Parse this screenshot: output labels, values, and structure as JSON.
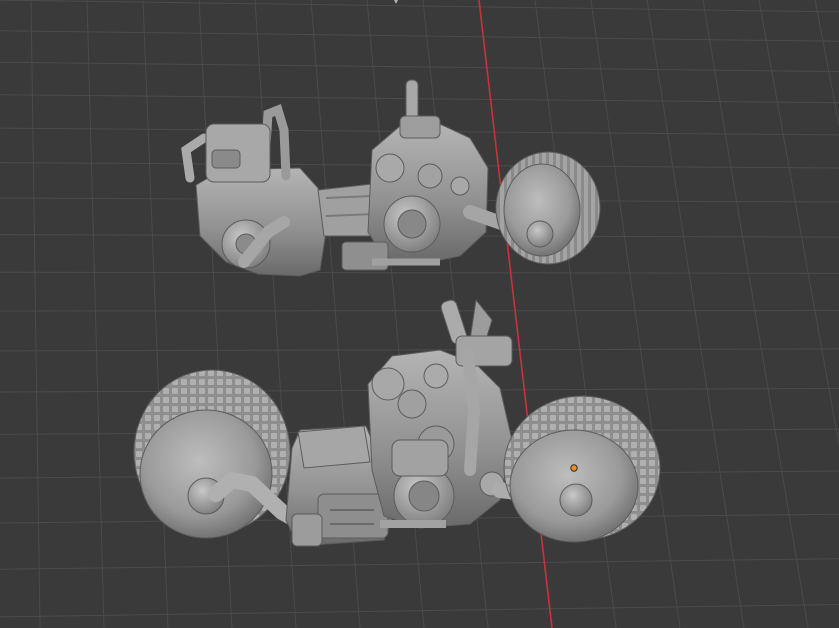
{
  "viewport": {
    "kind": "3d-viewport",
    "background_color": "#3a3a3a",
    "grid_line_color": "#4b4b4b",
    "y_axis_color": "#c8323a",
    "model_color": "#9a9a9a",
    "origin_color": "#f0901a"
  },
  "objects": [
    {
      "name": "motorbike-model",
      "view": "upper"
    },
    {
      "name": "motorbike-model",
      "view": "lower"
    }
  ],
  "origin_marker": {
    "icon": "object-origin-dot"
  }
}
